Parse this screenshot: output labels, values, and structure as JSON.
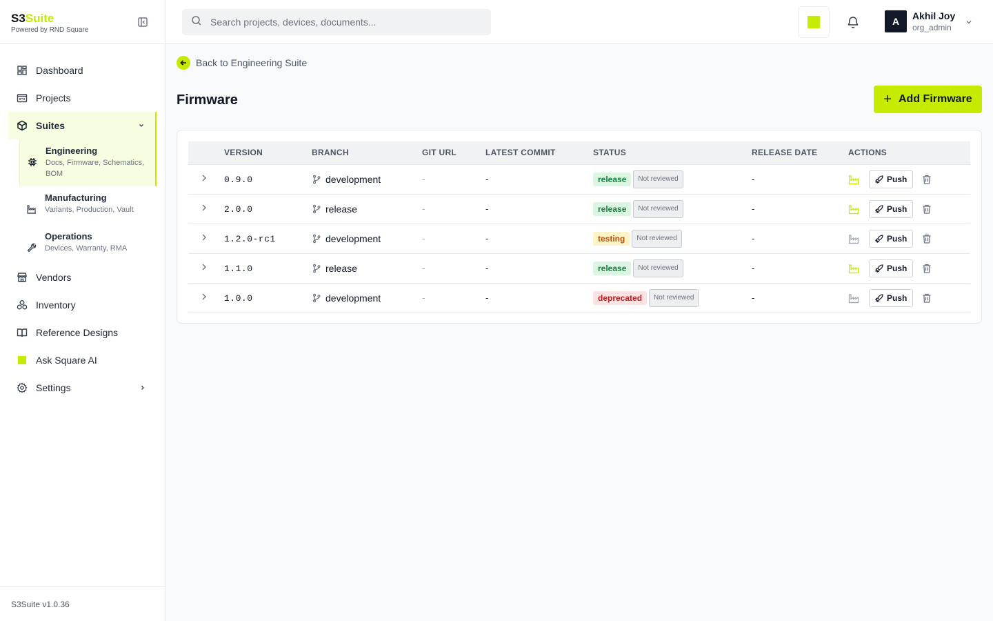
{
  "brand": {
    "name_prefix": "S3",
    "name_accent": "Suite",
    "subtitle": "Powered by RND Square"
  },
  "sidebar": {
    "items": [
      {
        "label": "Dashboard",
        "icon": "dashboard-icon"
      },
      {
        "label": "Projects",
        "icon": "projects-icon"
      },
      {
        "label": "Suites",
        "icon": "cube-icon",
        "active": true
      },
      {
        "label": "Vendors",
        "icon": "store-icon"
      },
      {
        "label": "Inventory",
        "icon": "boxes-icon"
      },
      {
        "label": "Reference Designs",
        "icon": "book-icon"
      },
      {
        "label": "Ask Square AI",
        "icon": "square-ai-icon"
      },
      {
        "label": "Settings",
        "icon": "gear-icon"
      }
    ],
    "suites": [
      {
        "title": "Engineering",
        "desc": "Docs, Firmware, Schematics, BOM",
        "icon": "chip-icon",
        "active": true
      },
      {
        "title": "Manufacturing",
        "desc": "Variants, Production, Vault",
        "icon": "factory-icon"
      },
      {
        "title": "Operations",
        "desc": "Devices, Warranty, RMA",
        "icon": "wrench-icon"
      }
    ],
    "footer": "S3Suite v1.0.36"
  },
  "header": {
    "search_placeholder": "Search projects, devices, documents...",
    "user": {
      "initial": "A",
      "name": "Akhil Joy",
      "role": "org_admin"
    }
  },
  "main": {
    "back_label": "Back to Engineering Suite",
    "title": "Firmware",
    "add_button": "Add Firmware",
    "table": {
      "columns": [
        "Version",
        "Branch",
        "Git URL",
        "Latest Commit",
        "Status",
        "Release Date",
        "Actions"
      ],
      "rows": [
        {
          "version": "0.9.0",
          "branch": "development",
          "git_url": "-",
          "commit": "-",
          "status": "release",
          "review": "Not reviewed",
          "release_date": "-",
          "push": "Push",
          "production_active": true
        },
        {
          "version": "2.0.0",
          "branch": "release",
          "git_url": "-",
          "commit": "-",
          "status": "release",
          "review": "Not reviewed",
          "release_date": "-",
          "push": "Push",
          "production_active": true
        },
        {
          "version": "1.2.0-rc1",
          "branch": "development",
          "git_url": "-",
          "commit": "-",
          "status": "testing",
          "review": "Not reviewed",
          "release_date": "-",
          "push": "Push",
          "production_active": false
        },
        {
          "version": "1.1.0",
          "branch": "release",
          "git_url": "-",
          "commit": "-",
          "status": "release",
          "review": "Not reviewed",
          "release_date": "-",
          "push": "Push",
          "production_active": true
        },
        {
          "version": "1.0.0",
          "branch": "development",
          "git_url": "-",
          "commit": "-",
          "status": "deprecated",
          "review": "Not reviewed",
          "release_date": "-",
          "push": "Push",
          "production_active": false
        }
      ]
    }
  },
  "colors": {
    "accent": "#c6ea00",
    "release": "#15803d",
    "testing": "#b45309",
    "deprecated": "#b91c1c"
  }
}
